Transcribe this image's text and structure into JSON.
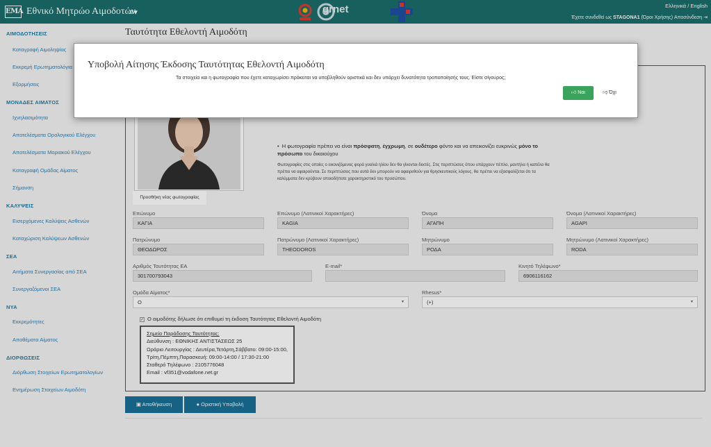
{
  "header": {
    "logo_text": "ΕΜΑ",
    "title": "Εθνικό Μητρώο Αιμοδοτών",
    "menu_icon": "≡▾",
    "grnet_text": "grnet",
    "language_links": "Ελληνικά / English",
    "login_prefix": "Έχετε συνδεθεί ως",
    "username": "STAGONA1",
    "terms_link": "(Όροι Χρήσης)",
    "logout_link": "Αποσύνδεση"
  },
  "sidebar": {
    "sections": [
      {
        "title": "ΑΙΜΟΔΟΤΗΣΕΙΣ",
        "items": [
          "Καταγραφή Αιμοληψίας",
          "Εκκρεμή Ερωτηματολόγια",
          "Εξορμήσεις"
        ]
      },
      {
        "title": "ΜΟΝΑΔΕΣ ΑΙΜΑΤΟΣ",
        "items": [
          "Ιχνηλασιμότητα",
          "Αποτελέσματα Ορολογικού Ελέγχου",
          "Αποτελέσματα Μοριακού Ελέγχου",
          "Καταγραφή Ομάδας Αίματος",
          "Σήμανση"
        ]
      },
      {
        "title": "ΚΑΛΥΨΕΙΣ",
        "items": [
          "Εισερχόμενες Καλύψεις Ασθενών",
          "Καταχώριση Καλύψεων Ασθενών"
        ]
      },
      {
        "title": "ΣΕΑ",
        "items": [
          "Αιτήματα Συνεργασίας από ΣΕΑ",
          "Συνεργαζόμενοι ΣΕΑ"
        ]
      },
      {
        "title": "ΝΥΑ",
        "items": [
          "Εκκρεμότητες",
          "Αποθέματα Αίματος"
        ]
      },
      {
        "title": "ΔΙΟΡΘΩΣΕΙΣ",
        "items": [
          "Διόρθωση Στοιχείων Ερωτηματολογίων",
          "Ενημέρωση Στοιχείων Αιμοδότη"
        ]
      }
    ]
  },
  "main": {
    "page_title": "Ταυτότητα Εθελοντή Αιμοδότη",
    "add_photo_label": "Προσθήκη νέας φωτογραφίας",
    "photo_note": {
      "p1": "Η φωτογραφία πρέπει να είναι ",
      "b1": "πρόσφατη",
      "p2": ", ",
      "b2": "έγχρωμη",
      "p3": ", σε ",
      "b3": "ουδέτερο",
      "p4": " φόντο και να απεικονίζει ευκρινώς ",
      "b4": "μόνο το πρόσωπο",
      "p5": " του δικαιούχου"
    },
    "photo_small_note": "Φωτογραφίες στις οποίες ο εικονιζόμενος φορά γυαλιά ηλίου δεν θα γίνονται δεκτές. Στις περιπτώσεις όπου υπάρχουν πέπλο, μαντήλα ή καπέλα θα πρέπει να αφαιρούνται. Σε περιπτώσεις που αυτά δεν μπορούν να αφαιρεθούν για θρησκευτικούς λόγους, θα πρέπει να εξασφαλίζεται ότι τα καλύμματα δεν κρύβουν οποιοδήποτε χαρακτηριστικό του προσώπου.",
    "fields": {
      "surname": {
        "label": "Επώνυμο",
        "value": "ΚΑΓΙΑ"
      },
      "surname_latin": {
        "label": "Επώνυμο (Λατινικοί Χαρακτήρες)",
        "value": "KAGIA"
      },
      "name": {
        "label": "Όνομα",
        "value": "ΑΓΑΠΗ"
      },
      "name_latin": {
        "label": "Όνομα (Λατινικοί Χαρακτήρες)",
        "value": "AGAPI"
      },
      "father": {
        "label": "Πατρώνυμο",
        "value": "ΘΕΟΔΩΡΟΣ"
      },
      "father_latin": {
        "label": "Πατρώνυμο (Λατινικοί Χαρακτήρες)",
        "value": "THEODOROS"
      },
      "mother": {
        "label": "Μητρώνυμο",
        "value": "ΡΟΔΑ"
      },
      "mother_latin": {
        "label": "Μητρώνυμο (Λατινικοί Χαρακτήρες)",
        "value": "RODA"
      },
      "id_number": {
        "label": "Αριθμός Ταυτότητας ΕΑ",
        "value": "301700793043"
      },
      "email": {
        "label": "E-mail*",
        "value": ""
      },
      "mobile": {
        "label": "Κινητό Τηλέφωνο*",
        "value": "6906116162"
      },
      "blood_group": {
        "label": "Ομάδα Αίματος*",
        "value": "O"
      },
      "rhesus": {
        "label": "Rhesus*",
        "value": "(+)"
      }
    },
    "consent_text": "Ο αιμοδότης δήλωσε ότι επιθυμεί τη έκδοση Ταυτότητας Εθελοντή Αιμοδότη",
    "delivery": {
      "title": "Σημείο Παράδοσης Ταυτότητας:",
      "address": "Διεύθυνση : ΕΘΝΙΚΗΣ ΑΝΤΙΣΤΑΣΕΩΣ 25",
      "hours": "Ωράριο Λειτουργίας : Δευτέρα,Τετάρτη,Σάββατο: 09:00-15:00, Τρίτη,Πέμπτη,Παρασκευή: 09:00-14:00 / 17:30-21:00",
      "phone": "Σταθερό Τηλέφωνο : 2105776048",
      "email": "Email : vf351@vodafone.net.gr"
    },
    "save_button": "Αποθήκευση",
    "final_submit_button": "Οριστική Υποβολή"
  },
  "modal": {
    "title": "Υποβολή Αίτησης Έκδοσης Ταυτότητας Εθελοντή Αιμοδότη",
    "message": "Τα στοιχεία και η φωτογραφία που έχετε καταχωρίσει πρόκειται να υποβληθούν οριστικά και δεν υπάρχει δυνατότητα τροποποίησής τους. Είστε σίγουρος;",
    "yes_label": "Ναι",
    "no_label": "Όχι"
  },
  "colors": {
    "header_bg": "#1c6e6b",
    "link_blue": "#2a7fb5",
    "button_blue": "#1a7097",
    "yes_green": "#3aa35c"
  }
}
